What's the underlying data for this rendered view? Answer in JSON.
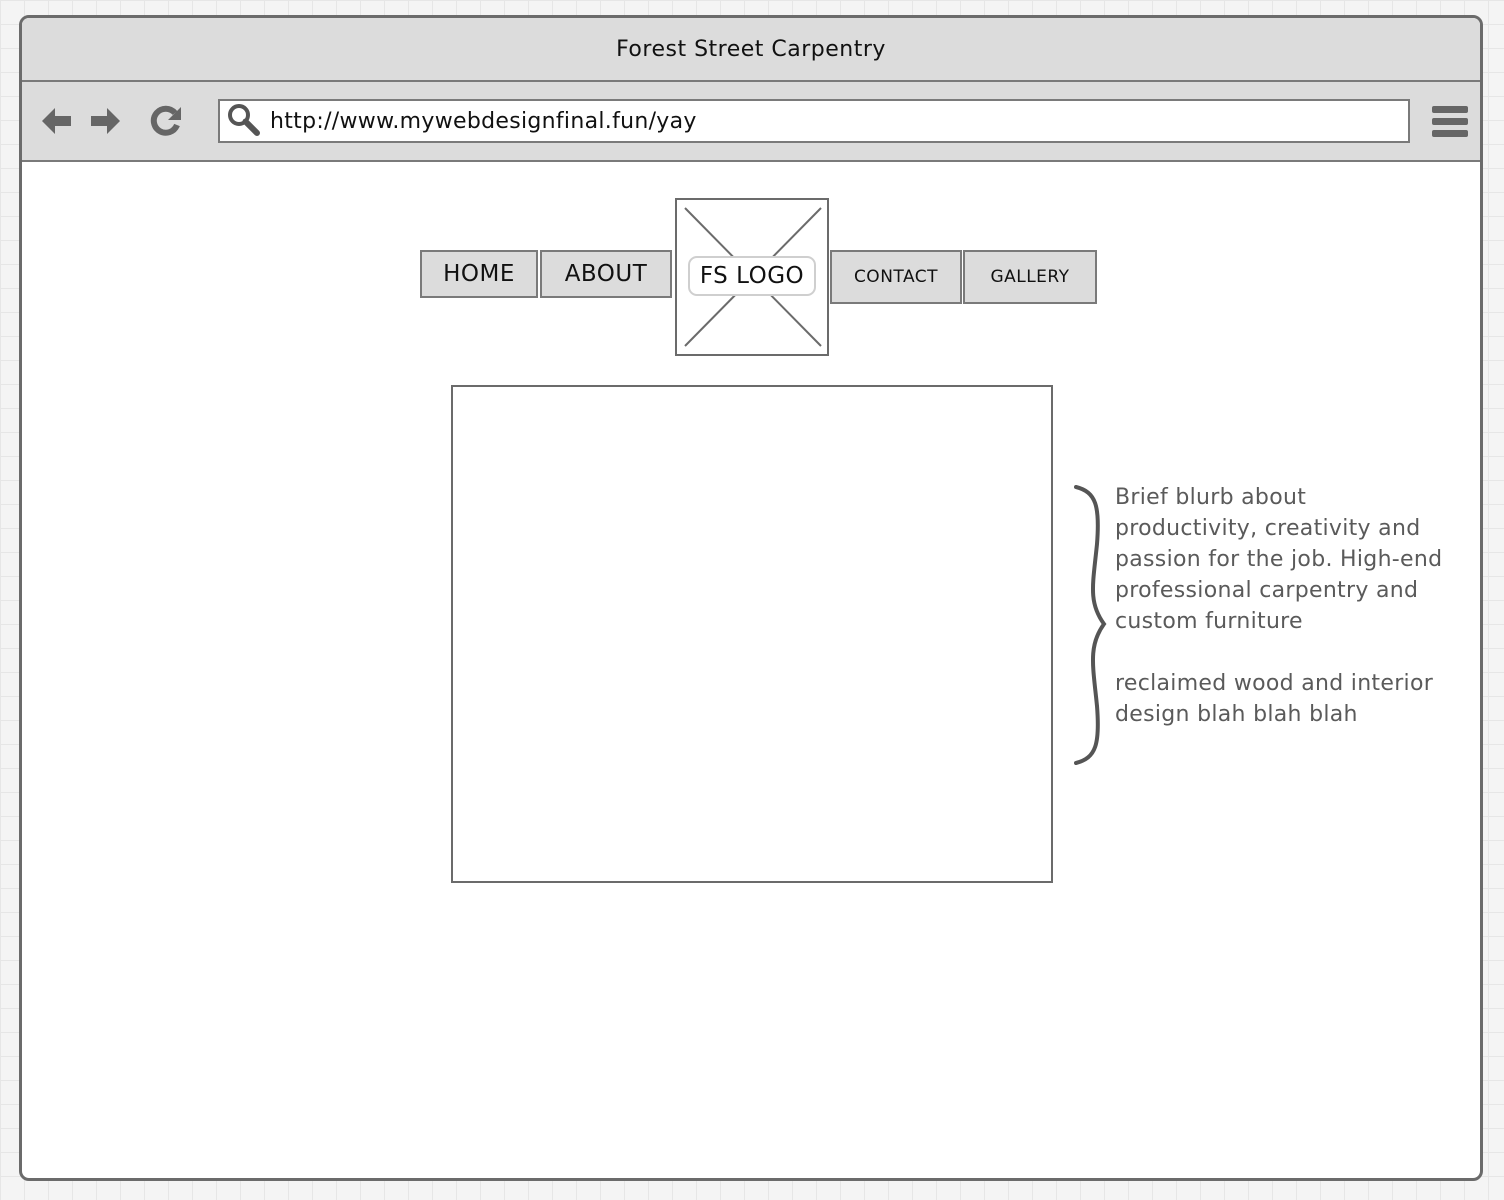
{
  "window": {
    "title": "Forest Street Carpentry"
  },
  "toolbar": {
    "back_icon": "arrow-left-icon",
    "forward_icon": "arrow-right-icon",
    "reload_icon": "reload-icon",
    "search_icon": "search-icon",
    "menu_icon": "hamburger-menu-icon",
    "url": "http://www.mywebdesignfinal.fun/yay"
  },
  "nav": {
    "home": "HOME",
    "about": "ABOUT",
    "logo": "FS LOGO",
    "contact": "CONTACT",
    "gallery": "GALLERY"
  },
  "blurb": {
    "paragraph_1": "Brief blurb about productivity, creativity and passion for the job. High-end professional carpentry and custom furniture",
    "paragraph_2": "reclaimed wood and interior design blah blah blah"
  },
  "colors": {
    "chrome": "#dcdcdc",
    "border": "#6b6b6b",
    "annotation_text": "#5a5a5a"
  }
}
